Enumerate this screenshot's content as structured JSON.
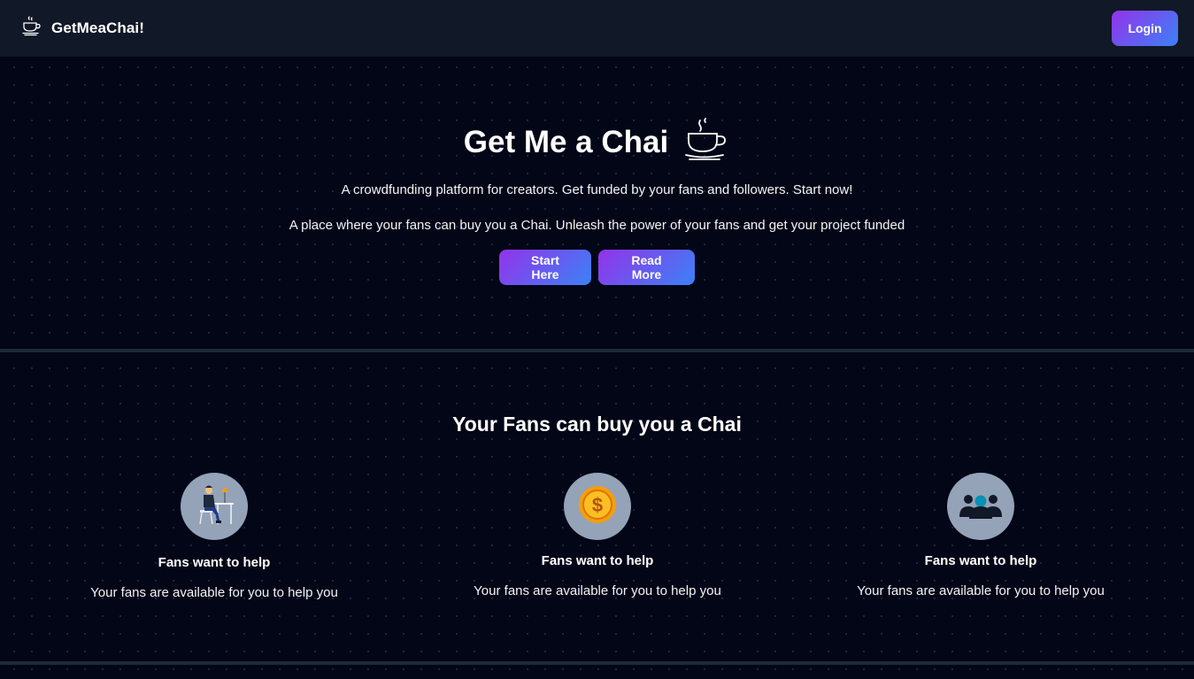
{
  "navbar": {
    "brand": "GetMeaChai!",
    "login_label": "Login"
  },
  "hero": {
    "title": "Get Me a Chai",
    "line1": "A crowdfunding platform for creators. Get funded by your fans and followers. Start now!",
    "line2": "A place where your fans can buy you a Chai. Unleash the power of your fans and get your project funded",
    "start_label": "Start Here",
    "read_more_label": "Read More"
  },
  "fans": {
    "title": "Your Fans can buy you a Chai",
    "features": [
      {
        "icon": "man-working-icon",
        "title": "Fans want to help",
        "desc": "Your fans are available for you to help you"
      },
      {
        "icon": "coin-icon",
        "title": "Fans want to help",
        "desc": "Your fans are available for you to help you"
      },
      {
        "icon": "group-icon",
        "title": "Fans want to help",
        "desc": "Your fans are available for you to help you"
      }
    ]
  },
  "colors": {
    "background": "#020617",
    "navbar": "#111827",
    "gradient_start": "#9333ea",
    "gradient_end": "#3b82f6",
    "circle": "#94a3b8"
  }
}
